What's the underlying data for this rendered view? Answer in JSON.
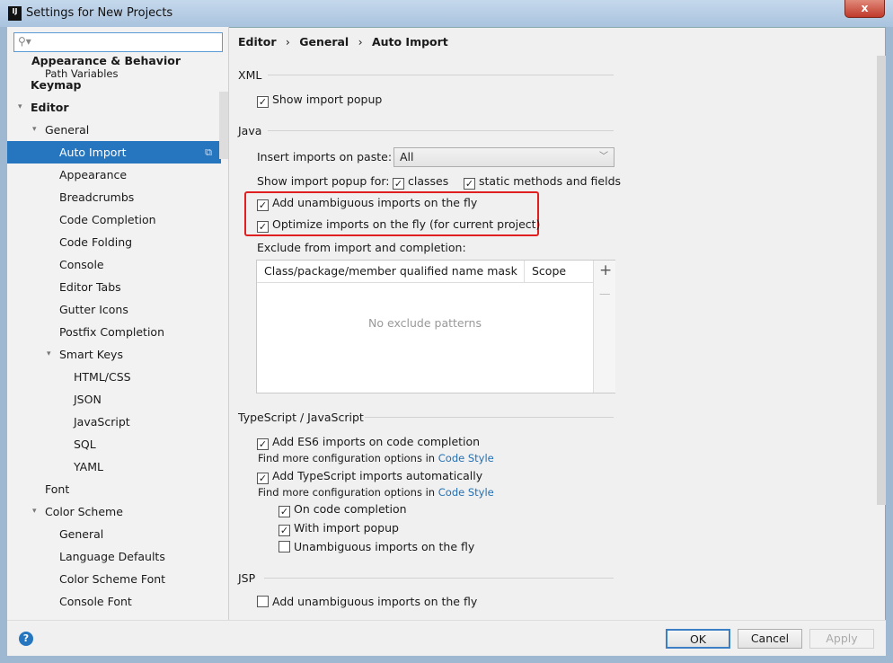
{
  "window": {
    "title": "Settings for New Projects",
    "logo": "IJ",
    "close": "x"
  },
  "search": {
    "placeholder": "",
    "icon": "search-icon"
  },
  "sidebar": {
    "items": [
      {
        "label": "Appearance & Behavior",
        "bold": true
      },
      {
        "label": "Path Variables"
      },
      {
        "label": "Keymap",
        "bold": true
      },
      {
        "label": "Editor",
        "bold": true
      },
      {
        "label": "General"
      },
      {
        "label": "Auto Import",
        "selected": true
      },
      {
        "label": "Appearance"
      },
      {
        "label": "Breadcrumbs"
      },
      {
        "label": "Code Completion"
      },
      {
        "label": "Code Folding"
      },
      {
        "label": "Console"
      },
      {
        "label": "Editor Tabs"
      },
      {
        "label": "Gutter Icons"
      },
      {
        "label": "Postfix Completion"
      },
      {
        "label": "Smart Keys"
      },
      {
        "label": "HTML/CSS"
      },
      {
        "label": "JSON"
      },
      {
        "label": "JavaScript"
      },
      {
        "label": "SQL"
      },
      {
        "label": "YAML"
      },
      {
        "label": "Font"
      },
      {
        "label": "Color Scheme"
      },
      {
        "label": "General"
      },
      {
        "label": "Language Defaults"
      },
      {
        "label": "Color Scheme Font"
      },
      {
        "label": "Console Font"
      }
    ]
  },
  "breadcrumb": {
    "parts": [
      "Editor",
      "General",
      "Auto Import"
    ],
    "sep": "›"
  },
  "xml": {
    "title": "XML",
    "show_popup": {
      "label": "Show import popup",
      "checked": true
    }
  },
  "java": {
    "title": "Java",
    "insert_label": "Insert imports on paste:",
    "insert_value": "All",
    "show_popup_label": "Show import popup for:",
    "classes": {
      "label": "classes",
      "checked": true
    },
    "static": {
      "label": "static methods and fields",
      "checked": true
    },
    "unambiguous": {
      "label": "Add unambiguous imports on the fly",
      "checked": true
    },
    "optimize": {
      "label": "Optimize imports on the fly (for current project)",
      "checked": true
    },
    "exclude_label": "Exclude from import and completion:",
    "table": {
      "columns": [
        "Class/package/member qualified name mask",
        "Scope"
      ],
      "empty": "No exclude patterns",
      "add": "+",
      "remove": "—"
    }
  },
  "ts": {
    "title": "TypeScript / JavaScript",
    "es6": {
      "label": "Add ES6 imports on code completion",
      "checked": true
    },
    "more1": "Find more configuration options in ",
    "link1": "Code Style",
    "tsauto": {
      "label": "Add TypeScript imports automatically",
      "checked": true
    },
    "more2": "Find more configuration options in ",
    "link2": "Code Style",
    "on_completion": {
      "label": "On code completion",
      "checked": true
    },
    "with_popup": {
      "label": "With import popup",
      "checked": true
    },
    "unamb": {
      "label": "Unambiguous imports on the fly",
      "checked": false
    }
  },
  "jsp": {
    "title": "JSP",
    "unamb": {
      "label": "Add unambiguous imports on the fly",
      "checked": false
    }
  },
  "buttons": {
    "help": "?",
    "ok": "OK",
    "cancel": "Cancel",
    "apply": "Apply"
  },
  "colors": {
    "selection": "#2675bf",
    "highlight": "#e02020",
    "link": "#2470b3"
  }
}
